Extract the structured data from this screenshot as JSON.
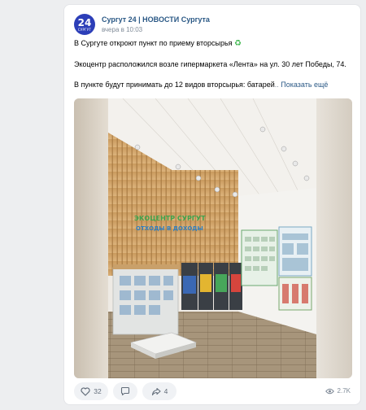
{
  "post": {
    "author": "Сургут 24 | НОВОСТИ Сургута",
    "time": "вчера в 10:03",
    "avatar": {
      "number": "24",
      "city": "СУРГУТ"
    },
    "lines": {
      "title": "В Сургуте откроют пункт по приему вторсырья",
      "title_emoji": "♻",
      "location": "Экоцентр расположился возле гипермаркета «Лента» на ул. 30 лет Победы, 74.",
      "details": "В пункте будут принимать до 12 видов вторсырья: батарей",
      "show_more": "Показать ещё"
    },
    "photo_sign": {
      "line1": "ЭКОЦЕНТР СУРГУТ",
      "line2": "ОТХОДЫ В ДОХОДЫ"
    }
  },
  "actions": {
    "likes": "32",
    "shares": "4",
    "views": "2.7K"
  },
  "icons": {
    "like": "heart-icon",
    "comment": "comment-icon",
    "share": "share-icon",
    "views": "eye-icon"
  },
  "colors": {
    "link": "#2a5885",
    "avatar_bg": "#2c3eb8",
    "muted": "#818c99"
  }
}
